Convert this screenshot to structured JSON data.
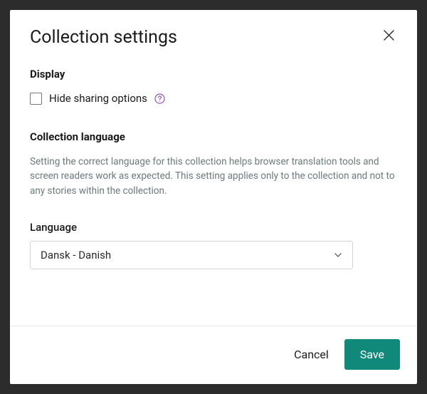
{
  "modal": {
    "title": "Collection settings"
  },
  "display": {
    "heading": "Display",
    "hide_sharing_label": "Hide sharing options"
  },
  "language_section": {
    "heading": "Collection language",
    "description": "Setting the correct language for this collection helps browser translation tools and screen readers work as expected. This setting applies only to the collection and not to any stories within the collection.",
    "field_label": "Language",
    "selected_value": "Dansk - Danish"
  },
  "footer": {
    "cancel_label": "Cancel",
    "save_label": "Save"
  }
}
